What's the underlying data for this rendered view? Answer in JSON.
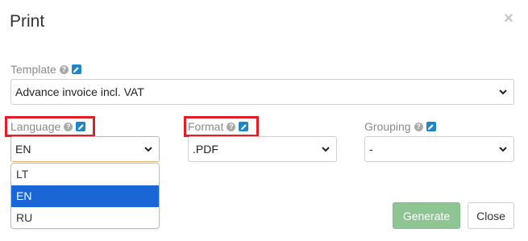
{
  "dialog": {
    "title": "Print",
    "close_glyph": "×"
  },
  "fields": {
    "template": {
      "label": "Template",
      "value": "Advance invoice incl. VAT"
    },
    "language": {
      "label": "Language",
      "value": "EN",
      "options": [
        "LT",
        "EN",
        "RU"
      ],
      "selected_index": 1
    },
    "format": {
      "label": "Format",
      "value": ".PDF"
    },
    "grouping": {
      "label": "Grouping",
      "value": "-"
    }
  },
  "buttons": {
    "generate": "Generate",
    "close": "Close"
  },
  "colors": {
    "highlight_box": "#e21e27",
    "edit_icon": "#1f87c9",
    "generate_button": "#8fc592",
    "selected_option": "#1a66d6"
  },
  "icons": {
    "help": "question-circle-icon",
    "edit": "pencil-icon",
    "dropdown": "chevron-down-icon"
  }
}
